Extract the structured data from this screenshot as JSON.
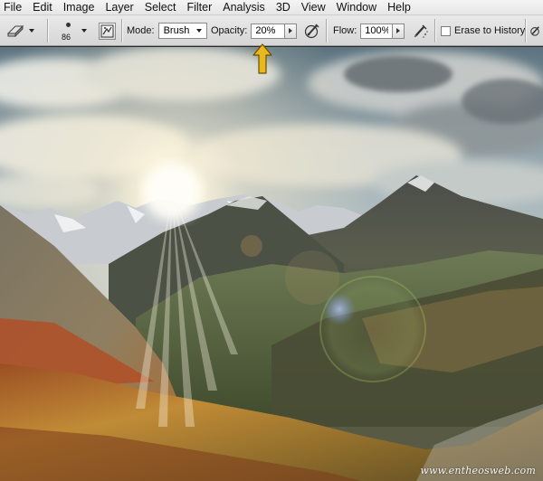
{
  "menu": {
    "items": [
      "File",
      "Edit",
      "Image",
      "Layer",
      "Select",
      "Filter",
      "Analysis",
      "3D",
      "View",
      "Window",
      "Help"
    ]
  },
  "options": {
    "brush_size": "86",
    "mode_label": "Mode:",
    "mode_value": "Brush",
    "opacity_label": "Opacity:",
    "opacity_value": "20%",
    "flow_label": "Flow:",
    "flow_value": "100%",
    "erase_history_label": "Erase to History",
    "erase_history_checked": false
  },
  "icons": {
    "tool_preset": "eraser-icon",
    "brush_preview": "brush-tip-icon",
    "brush_panel": "brush-panel-icon",
    "opacity_pressure": "pressure-opacity-icon",
    "airbrush": "airbrush-icon",
    "annotation": "yellow-arrow-icon"
  },
  "colors": {
    "annotation_arrow": "#e8b81c"
  },
  "canvas": {
    "watermark": "www.entheosweb.com"
  }
}
